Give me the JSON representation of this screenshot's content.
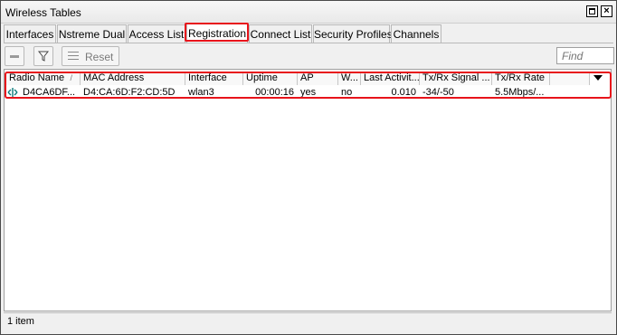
{
  "window": {
    "title": "Wireless Tables"
  },
  "tabs": [
    {
      "label": "Interfaces"
    },
    {
      "label": "Nstreme Dual"
    },
    {
      "label": "Access List"
    },
    {
      "label": "Registration",
      "active": true
    },
    {
      "label": "Connect List"
    },
    {
      "label": "Security Profiles"
    },
    {
      "label": "Channels"
    }
  ],
  "toolbar": {
    "reset_label": "Reset",
    "find_placeholder": "Find"
  },
  "table": {
    "columns": [
      "Radio Name",
      "MAC Address",
      "Interface",
      "Uptime",
      "AP",
      "W...",
      "Last Activit...",
      "Tx/Rx Signal ...",
      "Tx/Rx Rate"
    ],
    "sorted_column": "Radio Name",
    "rows": [
      {
        "radio_name": "D4CA6DF...",
        "mac_address": "D4:CA:6D:F2:CD:5D",
        "interface": "wlan3",
        "uptime": "00:00:16",
        "ap": "yes",
        "w": "no",
        "last_activity": "0.010",
        "signal": "-34/-50",
        "rate": "5.5Mbps/..."
      }
    ]
  },
  "status": {
    "count_text": "1 item"
  },
  "colors": {
    "highlight": "#e8141b",
    "accent": "#0b7a7a"
  }
}
